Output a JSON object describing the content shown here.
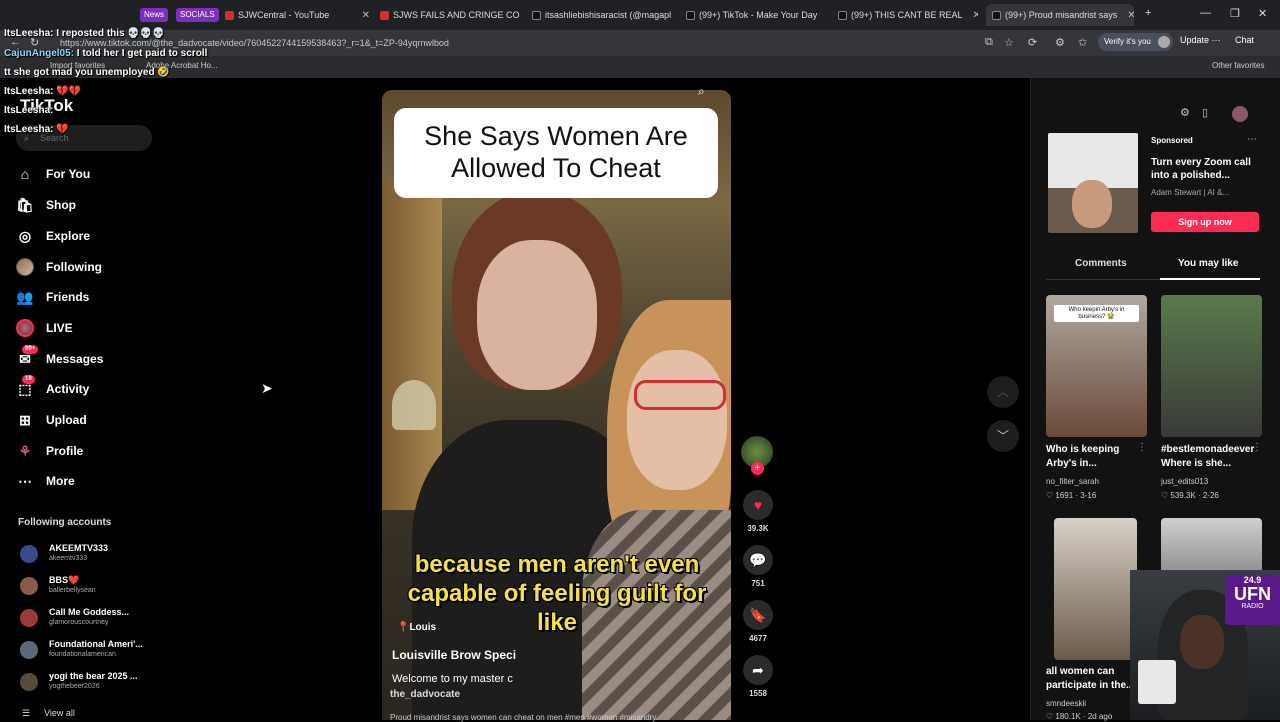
{
  "browser": {
    "chips": [
      {
        "label": "News",
        "color": "#7b2fbe"
      },
      {
        "label": "SOCIALS",
        "color": "#7b2fbe"
      }
    ],
    "tabs": [
      {
        "title": "SJWCentral - YouTube",
        "fav": "#d32f2f"
      },
      {
        "title": "SJWS FAILS AND CRINGE COMP",
        "fav": "#d32f2f"
      },
      {
        "title": "itsashliebishisaracist (@magapl",
        "fav": "#111111"
      },
      {
        "title": "(99+) TikTok - Make Your Day",
        "fav": "#111111"
      },
      {
        "title": "(99+) THIS CANT BE REAL",
        "fav": "#111111"
      },
      {
        "title": "(99+) Proud misandrist says",
        "fav": "#111111"
      }
    ],
    "url": "https://www.tiktok.com/@the_dadvocate/video/7604522744159538463?_r=1&_t=ZP-94yqrnwlbod",
    "verify_label": "Verify it's you",
    "update_label": "Update",
    "chat_label": "Chat",
    "favorites": [
      "Import favorites",
      "Adobe Acrobat Ho..."
    ],
    "other_favorites": "Other favorites"
  },
  "chat_overlay": [
    {
      "user": "ItsLeesha:",
      "msg": "I reposted this 💀💀💀",
      "blue": false
    },
    {
      "user": "CajunAngel05:",
      "msg": "I told her I get paid to scroll",
      "blue": true
    },
    {
      "user": "",
      "msg": "tt she got mad you unemployed 🤣",
      "blue": false
    },
    {
      "user": "ItsLeesha:",
      "msg": "💔💔",
      "blue": false
    },
    {
      "user": "ItsLeesha:",
      "msg": "",
      "blue": false
    },
    {
      "user": "ItsLeesha:",
      "msg": "💔",
      "blue": false
    }
  ],
  "sidebar": {
    "logo": "TikTok",
    "search_placeholder": "Search",
    "nav": [
      {
        "label": "For You",
        "icon": "home-icon"
      },
      {
        "label": "Shop",
        "icon": "bag-icon"
      },
      {
        "label": "Explore",
        "icon": "compass-icon"
      },
      {
        "label": "Following",
        "icon": "avatar-icon"
      },
      {
        "label": "Friends",
        "icon": "people-icon"
      },
      {
        "label": "LIVE",
        "icon": "live-icon"
      },
      {
        "label": "Messages",
        "icon": "message-icon",
        "badge": "99+"
      },
      {
        "label": "Activity",
        "icon": "activity-icon",
        "badge": "18"
      },
      {
        "label": "Upload",
        "icon": "upload-icon"
      },
      {
        "label": "Profile",
        "icon": "profile-icon"
      },
      {
        "label": "More",
        "icon": "more-icon"
      }
    ],
    "following_title": "Following accounts",
    "following": [
      {
        "name": "AKEEMTV333",
        "handle": "akeemtv333",
        "color": "#3a4a8a"
      },
      {
        "name": "BBS❤️",
        "handle": "ballerbellysean",
        "color": "#8a5a4a"
      },
      {
        "name": "Call Me Goddess...",
        "handle": "glamorouscourtney",
        "color": "#9a3a3a"
      },
      {
        "name": "Foundational Ameri'...",
        "handle": "foundationalamerican",
        "color": "#5a6a7a"
      },
      {
        "name": "yogi the bear 2025 ...",
        "handle": "yogthebeer2026",
        "color": "#5a4a3a"
      }
    ],
    "view_all": "View all"
  },
  "video": {
    "title_card": "She Says Women Are Allowed To Cheat",
    "caption": "because men aren't even capable of feeling guilt for like",
    "location_tag": "Louis",
    "title": "Louisville Brow Speci",
    "description": "Welcome to my master c",
    "username": "the_dadvocate",
    "bottom_text": "Proud misandrist says women can cheat on men #men #women #misandry"
  },
  "actions": {
    "likes": "39.3K",
    "comments": "751",
    "saves": "4677",
    "shares": "1558"
  },
  "right_panel": {
    "sponsored_label": "Sponsored",
    "ad_text": "Turn every Zoom call into a polished...",
    "ad_author": "Adam Stewart | AI &...",
    "signup_label": "Sign up now",
    "tabs": [
      "Comments",
      "You may like"
    ],
    "recommendations": [
      {
        "title": "Who is keeping Arby's in...",
        "user": "no_filter_sarah",
        "stats": "♡ 1691 · 3-16",
        "thumb_text": "Who keepin Arby's in business? 😭",
        "color": "#6a4a3a"
      },
      {
        "title": "#bestlemonadeever Where is she...",
        "user": "just_edits013",
        "stats": "♡ 539.3K · 2-26",
        "thumb_text": "",
        "color": "#4a5a3a"
      },
      {
        "title": "all women can participate in the...",
        "user": "smndeeskii",
        "stats": "♡ 180.1K · 2d ago",
        "thumb_text": "",
        "color": "#6a5a4a"
      },
      {
        "title": "",
        "user": "",
        "stats": "",
        "thumb_text": "",
        "color": "#8a8a8a"
      }
    ]
  },
  "streamer_overlay": {
    "frequency": "24.9",
    "station": "UFN",
    "radio": "RADIO"
  }
}
